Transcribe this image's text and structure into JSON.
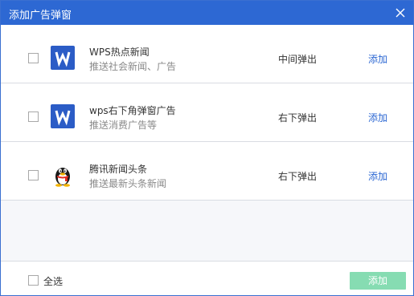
{
  "window": {
    "title": "添加广告弹窗",
    "close_icon": "close-icon"
  },
  "items": [
    {
      "icon": "wps-icon",
      "name": "WPS热点新闻",
      "description": "推送社会新闻、广告",
      "position": "中间弹出",
      "action": "添加",
      "checked": false
    },
    {
      "icon": "wps-icon",
      "name": "wps右下角弹窗广告",
      "description": "推送消费广告等",
      "position": "右下弹出",
      "action": "添加",
      "checked": false
    },
    {
      "icon": "qq-penguin-icon",
      "name": "腾讯新闻头条",
      "description": "推送最新头条新闻",
      "position": "右下弹出",
      "action": "添加",
      "checked": false
    }
  ],
  "footer": {
    "select_all_label": "全选",
    "select_all_checked": false,
    "add_button_label": "添加",
    "add_button_enabled": false
  },
  "colors": {
    "titlebar": "#2d68d3",
    "link": "#2d68d3",
    "add_button_disabled": "#86dcb2",
    "wps_blue": "#2b5cc6"
  }
}
